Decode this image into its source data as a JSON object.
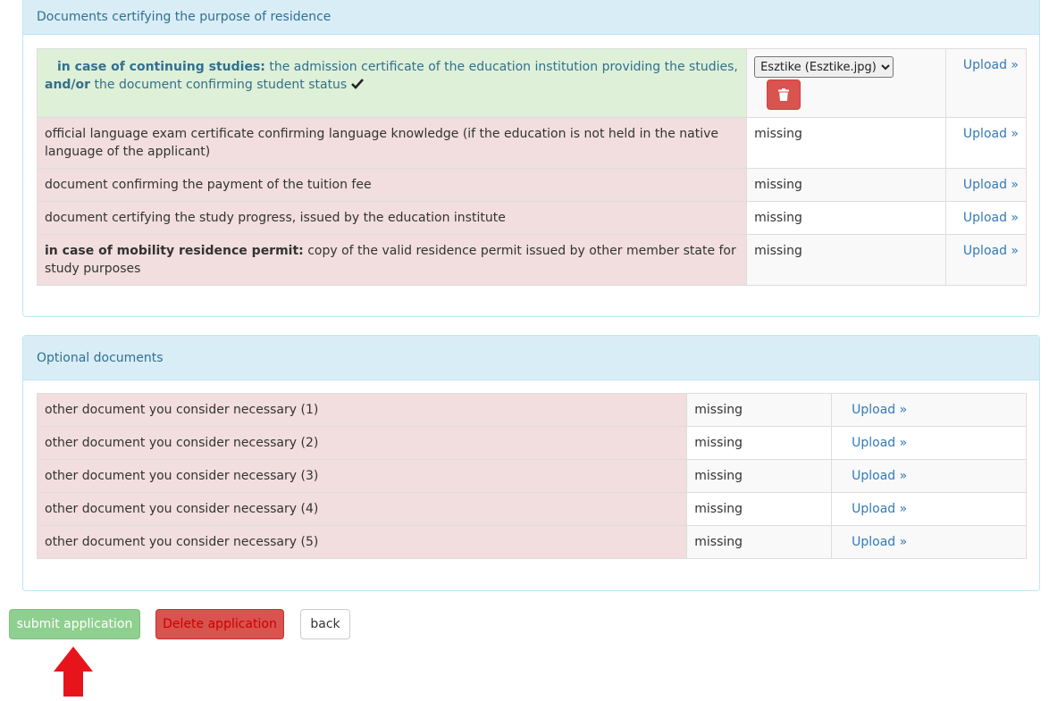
{
  "panel_purpose": {
    "heading": "Documents certifying the purpose of residence",
    "rows": [
      {
        "prefix_bold": "in case of continuing studies:",
        "text1": " the admission certificate of the education institution providing the studies, ",
        "text_bold2": "and/or",
        "text2": " the document confirming student status",
        "selected_file": "Esztike (Esztike.jpg)",
        "upload": "Upload »"
      },
      {
        "text": "official language exam certificate confirming language knowledge (if the education is not held in the native language of the applicant)",
        "status": "missing",
        "upload": "Upload »"
      },
      {
        "text": "document confirming the payment of the tuition fee",
        "status": "missing",
        "upload": "Upload »"
      },
      {
        "text": "document certifying the study progress, issued by the education institute",
        "status": "missing",
        "upload": "Upload »"
      },
      {
        "prefix_bold": "in case of mobility residence permit:",
        "text": " copy of the valid residence permit issued by other member state for study purposes",
        "status": "missing",
        "upload": "Upload »"
      }
    ]
  },
  "panel_optional": {
    "heading": "Optional documents",
    "rows": [
      {
        "text": "other document you consider necessary (1)",
        "status": "missing",
        "upload": "Upload »"
      },
      {
        "text": "other document you consider necessary (2)",
        "status": "missing",
        "upload": "Upload »"
      },
      {
        "text": "other document you consider necessary (3)",
        "status": "missing",
        "upload": "Upload »"
      },
      {
        "text": "other document you consider necessary (4)",
        "status": "missing",
        "upload": "Upload »"
      },
      {
        "text": "other document you consider necessary (5)",
        "status": "missing",
        "upload": "Upload »"
      }
    ]
  },
  "buttons": {
    "submit": "submit application",
    "delete": "Delete application",
    "back": "back"
  },
  "colors": {
    "accent_arrow": "#e8141c",
    "row_ok": "#dff0d8",
    "row_missing": "#f2dede",
    "panel_heading": "#d9edf7"
  }
}
